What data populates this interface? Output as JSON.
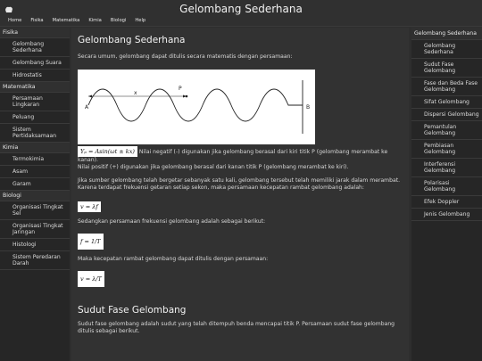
{
  "header": {
    "title": "Gelombang Sederhana"
  },
  "menu": [
    "Home",
    "Fisika",
    "Matematika",
    "Kimia",
    "Biologi",
    "Help"
  ],
  "left_nav": [
    {
      "section": "Fisika",
      "items": [
        "Gelombang Sederhana",
        "Gelombang Suara",
        "Hidrostatis"
      ]
    },
    {
      "section": "Matematika",
      "items": [
        "Persamaan Lingkaran",
        "Peluang",
        "Sistem Pertidaksamaan"
      ]
    },
    {
      "section": "Kimia",
      "items": [
        "Termokimia",
        "Asam",
        "Garam"
      ]
    },
    {
      "section": "Biologi",
      "items": [
        "Organisasi Tingkat Sel",
        "Organisasi Tingkat Jaringan",
        "Histologi",
        "Sistem Peredaran Darah"
      ]
    }
  ],
  "main": {
    "title": "Gelombang Sederhana",
    "intro": "Secara umum, gelombang dapat ditulis secara matematis dengan persamaan:",
    "figure_labels": {
      "a": "A",
      "x": "x",
      "p": "P",
      "b": "B"
    },
    "formula1": "Yₚ = Asin(ωt ± kx)",
    "p1a": "Nilai negatif (-) digunakan jika gelombang berasal dari kiri titik P (gelombang merambat ke kanan).",
    "p1b": "Nilai positif (+) digunakan jika gelombang berasal dari kanan titik P (gelombang merambat ke kiri).",
    "p2": "Jika sumber gelombang telah bergetar sebanyak satu kali, gelombang tersebut telah memiliki jarak dalam merambat. Karena terdapat frekuensi getaran setiap sekon, maka persamaan kecepatan rambat gelombang adalah:",
    "formula2": "v = λf",
    "p3": "Sedangkan persamaan frekuensi gelombang adalah sebagai berikut:",
    "formula3": "f = 1/T",
    "p4": "Maka kecepatan rambat gelombang dapat ditulis dengan persamaan:",
    "formula4": "v = λ/T",
    "section2_title": "Sudut Fase Gelombang",
    "section2_text": "Sudut fase gelombang adalah sudut yang telah ditempuh benda mencapai titik P. Persamaan sudut fase gelombang ditulis sebagai berikut."
  },
  "right_nav": {
    "title": "Gelombang Sederhana",
    "items": [
      "Gelombang Sederhana",
      "Sudut Fase Gelombang",
      "Fase dan Beda Fase Gelombang",
      "Sifat Gelombang",
      "Dispersi Gelombang",
      "Pemantulan Gelombang",
      "Pembiasan Gelombang",
      "Interferensi Gelombang",
      "Polarisasi Gelombang",
      "Efek Doppler",
      "Jenis Gelombang"
    ]
  }
}
